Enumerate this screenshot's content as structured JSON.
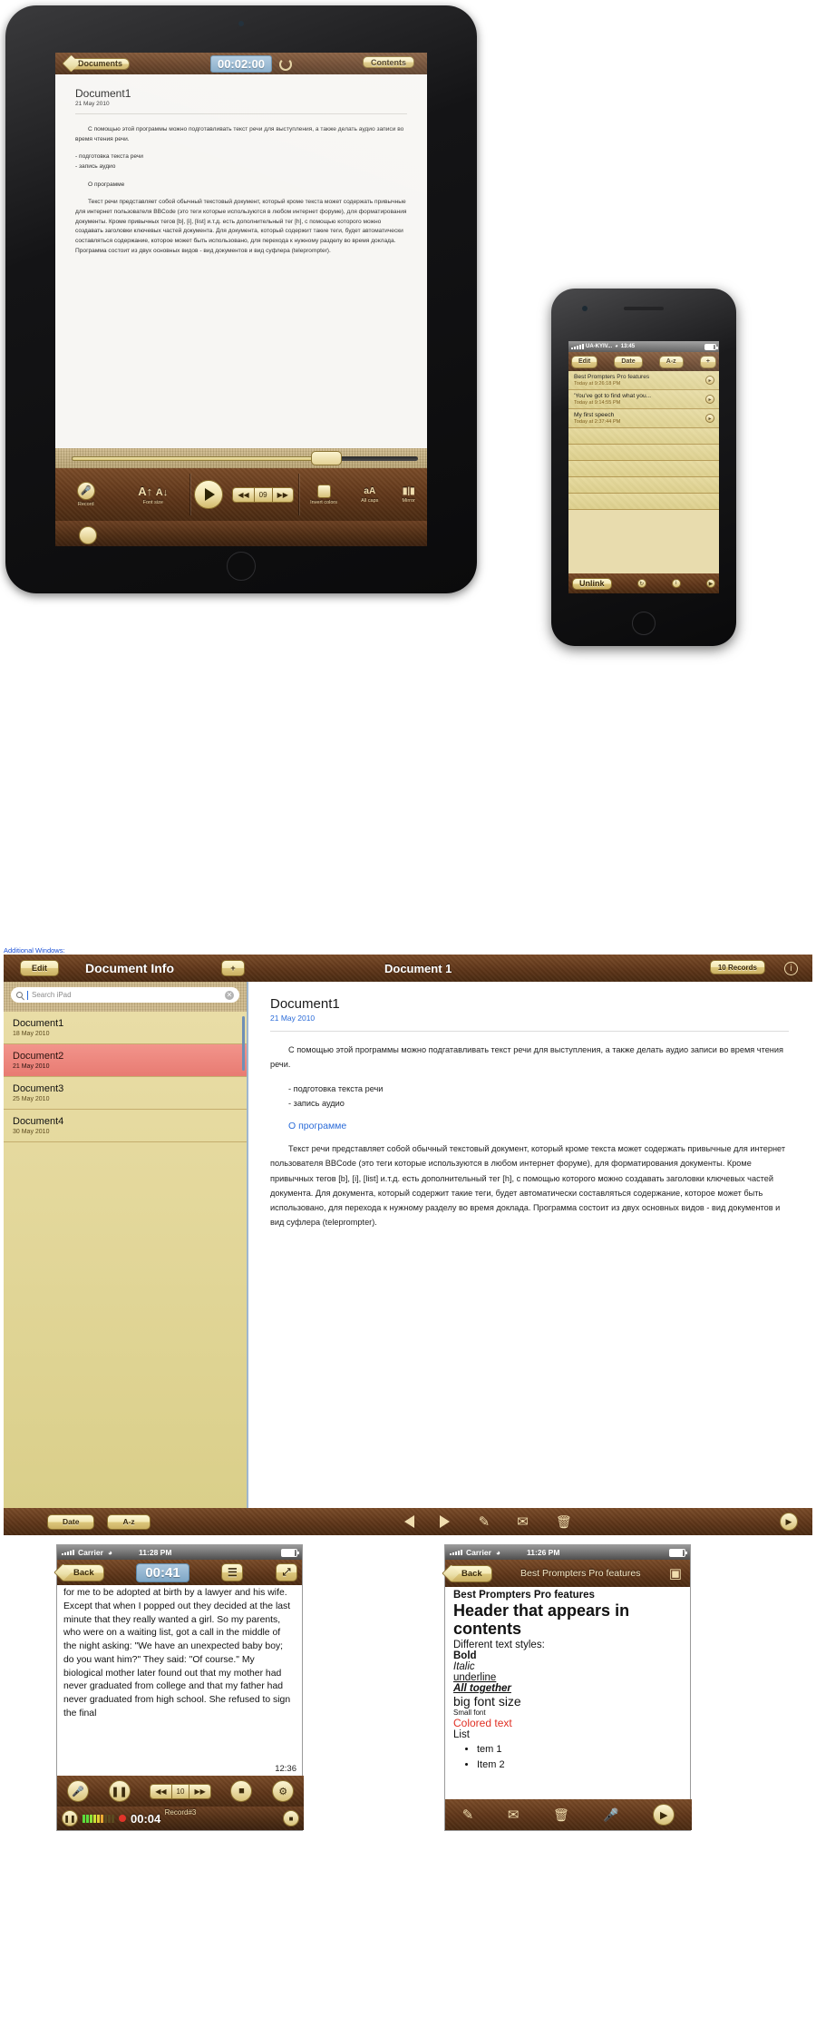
{
  "ipad": {
    "nav": {
      "back_label": "Documents",
      "timer": "00:02:00",
      "contents_label": "Contents",
      "reload_icon": "reload-icon"
    },
    "document": {
      "title": "Document1",
      "date": "21 May 2010",
      "paragraphs": [
        "С помощью этой программы можно подготавливать текст речи для выступления, а также делать аудио записи во время чтения речи.",
        "- подготовка текста речи\n- запись аудио",
        "О программе",
        "Текст речи представляет собой обычный текстовый документ, который кроме текста может содержать привычные для интернет пользователя BBCode (это теги которые используются в любом интернет форуме), для форматирования документы. Кроме привычных тегов [b], [i], [list] и.т.д. есть дополнительный тег [h], с помощью которого можно создавать заголовки ключевых частей документа. Для документа, который содержит такие теги, будет автоматически составляться содержание, которое может быть использовано, для перехода к нужному разделу во время доклада. Программа состоит из двух основных видов - вид документов и вид суфлера (teleprompter)."
      ]
    },
    "toolbar": {
      "record_label": "Record",
      "record_icon": "microphone-icon",
      "fontsize_label": "Font size",
      "font_up_icon": "font-increase-icon",
      "font_down_icon": "font-decrease-icon",
      "play_icon": "play-icon",
      "rewind_icon": "rewind-icon",
      "speed_value": "09",
      "forward_icon": "forward-icon",
      "invert_label": "Invert colors",
      "invert_icon": "invert-colors-icon",
      "allcaps_label": "All caps",
      "allcaps_icon": "all-caps-icon",
      "mirror_label": "Mirror",
      "mirror_icon": "mirror-icon"
    }
  },
  "iphone": {
    "status": {
      "carrier": "UA-KYIV...",
      "wifi_icon": "wifi-icon",
      "time": "13:45",
      "battery_icon": "battery-icon"
    },
    "nav": {
      "edit_label": "Edit",
      "date_label": "Date",
      "az_label": "A-z",
      "add_label": "+"
    },
    "list": [
      {
        "title": "Best Prompters Pro features",
        "subtitle": "Today at 9:26:18 PM"
      },
      {
        "title": "'You've got to find what you...",
        "subtitle": "Today at 9:14:55 PM"
      },
      {
        "title": "My first speech",
        "subtitle": "Today at 2:37:44 PM"
      }
    ],
    "bottom": {
      "unlink_label": "Unlink",
      "refresh_icon": "refresh-icon",
      "info_icon": "info-icon",
      "forward_icon": "forward-arrow-icon"
    }
  },
  "additional_windows_label": "Additional Windows:",
  "docwin": {
    "nav": {
      "edit_label": "Edit",
      "left_title": "Document Info",
      "add_label": "+",
      "center_title": "Document 1",
      "records_badge": "10 Records",
      "info_icon": "info-icon"
    },
    "search": {
      "placeholder": "Search iPad",
      "search_icon": "search-icon",
      "clear_icon": "clear-icon"
    },
    "documents": [
      {
        "title": "Document1",
        "date": "18 May 2010",
        "selected": false
      },
      {
        "title": "Document2",
        "date": "21 May 2010",
        "selected": true
      },
      {
        "title": "Document3",
        "date": "25 May 2010",
        "selected": false
      },
      {
        "title": "Document4",
        "date": "30 May 2010",
        "selected": false
      }
    ],
    "document": {
      "title": "Document1",
      "date": "21 May 2010",
      "para1": "С помощью этой программы можно подгатавливать текст речи для выступления, а также делать аудио записи во время чтения речи.",
      "para2": "- подготовка текста речи\n- запись аудио",
      "heading": "О программе",
      "para3": "Текст речи представляет собой обычный текстовый документ, который кроме текста может содержать привычные для интернет пользователя BBCode (это теги которые используются в любом интернет форуме), для форматирования документы. Кроме привычных тегов [b], [i], [list] и.т.д. есть дополнительный тег [h], с помощью которого можно создавать заголовки ключевых частей документа. Для документа, который содержит такие теги, будет автоматически составляться содержание, которое может быть использовано, для перехода к нужному разделу во время доклада. Программа состоит из двух основных видов - вид документов и вид суфлера (teleprompter)."
    },
    "footer": {
      "date_label": "Date",
      "az_label": "A-z",
      "prev_icon": "previous-arrow-icon",
      "next_icon": "next-arrow-icon",
      "edit_icon": "edit-pencil-icon",
      "mail_icon": "mail-icon",
      "trash_icon": "trash-icon",
      "play_icon": "play-circle-icon"
    }
  },
  "phone_left": {
    "status": {
      "carrier": "Carrier",
      "wifi_icon": "wifi-icon",
      "time": "11:28 PM",
      "battery_icon": "battery-icon"
    },
    "nav": {
      "back_label": "Back",
      "timer": "00:41",
      "list_icon": "list-icon",
      "expand_icon": "fullscreen-icon"
    },
    "body": "for me to be adopted at birth by a lawyer and his wife. Except that when I popped out they decided at the last minute that they really wanted a girl. So my parents, who were on a waiting list, got a call in the middle of the night asking: \"We have an unexpected baby boy; do you want him?\" They said: \"Of course.\" My biological mother later found out that my mother had never graduated from college and that my father had never graduated from high school. She refused to sign the final",
    "clock": "12:36",
    "controls": {
      "record_icon": "microphone-icon",
      "pause_icon": "pause-icon",
      "rewind_icon": "rewind-icon",
      "speed_value": "10",
      "forward_icon": "forward-icon",
      "stop_icon": "stop-icon",
      "settings_icon": "gear-icon"
    },
    "record_bar": {
      "label": "Record#3",
      "time": "00:04",
      "pause_icon": "pause-icon",
      "rec_dot_icon": "record-dot-icon",
      "stop_icon": "stop-icon"
    }
  },
  "phone_right": {
    "status": {
      "carrier": "Carrier",
      "wifi_icon": "wifi-icon",
      "time": "11:26 PM",
      "battery_icon": "battery-icon"
    },
    "nav": {
      "back_label": "Back",
      "title": "Best Prompters Pro features",
      "action_icon": "teleprompter-icon"
    },
    "content": {
      "line_bold": "Best Prompters Pro features",
      "header": "Header that appears in contents",
      "styles_label": "Different text styles:",
      "bold": "Bold",
      "italic": "Italic",
      "underline": "underline",
      "all_together": "All together",
      "big_font": "big font size",
      "small_font": "Small font",
      "colored_text": "Colored text",
      "colored_hex": "#e03024",
      "list_label": "List",
      "list_items": [
        "tem 1",
        "Item 2"
      ]
    },
    "footer": {
      "edit_icon": "edit-pencil-icon",
      "mail_icon": "mail-icon",
      "trash_icon": "trash-icon",
      "mic_icon": "microphone-icon",
      "play_icon": "play-circle-icon"
    }
  }
}
